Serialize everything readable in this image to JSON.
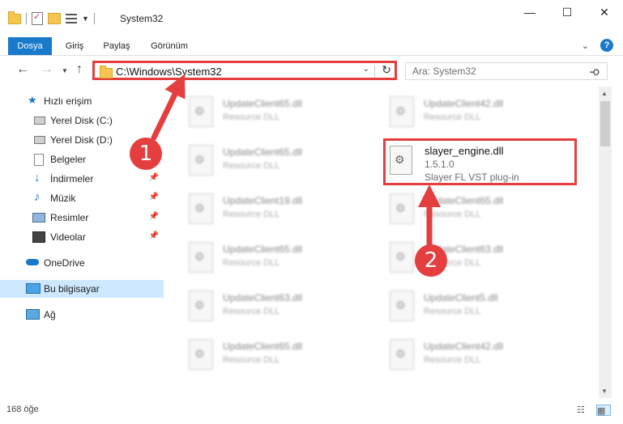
{
  "window": {
    "title": "System32"
  },
  "ribbon": {
    "tabs": [
      "Dosya",
      "Giriş",
      "Paylaş",
      "Görünüm"
    ]
  },
  "address": {
    "path": "C:\\Windows\\System32"
  },
  "search": {
    "placeholder": "Ara: System32"
  },
  "sidebar": {
    "items": [
      {
        "label": "Hızlı erişim",
        "icon": "star-icon"
      },
      {
        "label": "Yerel Disk (C:)",
        "icon": "drive-icon"
      },
      {
        "label": "Yerel Disk (D:)",
        "icon": "drive-icon"
      },
      {
        "label": "Belgeler",
        "icon": "documents-icon"
      },
      {
        "label": "İndirmeler",
        "icon": "download-icon"
      },
      {
        "label": "Müzik",
        "icon": "music-icon"
      },
      {
        "label": "Resimler",
        "icon": "pictures-icon"
      },
      {
        "label": "Videolar",
        "icon": "videos-icon"
      },
      {
        "label": "OneDrive",
        "icon": "cloud-icon"
      },
      {
        "label": "Bu bilgisayar",
        "icon": "computer-icon"
      },
      {
        "label": "Ağ",
        "icon": "network-icon"
      }
    ]
  },
  "files": {
    "left": [
      {
        "name": "UpdateClient65.dll",
        "desc": "Resource DLL"
      },
      {
        "name": "UpdateClient65.dll",
        "desc": "Resource DLL"
      },
      {
        "name": "UpdateClient19.dll",
        "desc": "Resource DLL"
      },
      {
        "name": "UpdateClient65.dll",
        "desc": "Resource DLL"
      },
      {
        "name": "UpdateClient63.dll",
        "desc": "Resource DLL"
      },
      {
        "name": "UpdateClient65.dll",
        "desc": "Resource DLL"
      }
    ],
    "right": [
      {
        "name": "UpdateClient42.dll",
        "desc": "Resource DLL"
      },
      {
        "name": "UpdateClient65.dll",
        "desc": "Resource DLL"
      },
      {
        "name": "UpdateClient63.dll",
        "desc": "Resource DLL"
      },
      {
        "name": "UpdateClient5.dll",
        "desc": "Resource DLL"
      },
      {
        "name": "UpdateClient42.dll",
        "desc": "Resource DLL"
      }
    ],
    "highlighted": {
      "name": "slayer_engine.dll",
      "version": "1.5.1.0",
      "description": "Slayer FL VST plug-in"
    }
  },
  "status": {
    "count": "168 öğe"
  },
  "annotations": {
    "step1": "1",
    "step2": "2",
    "color": "#e53e3e"
  }
}
